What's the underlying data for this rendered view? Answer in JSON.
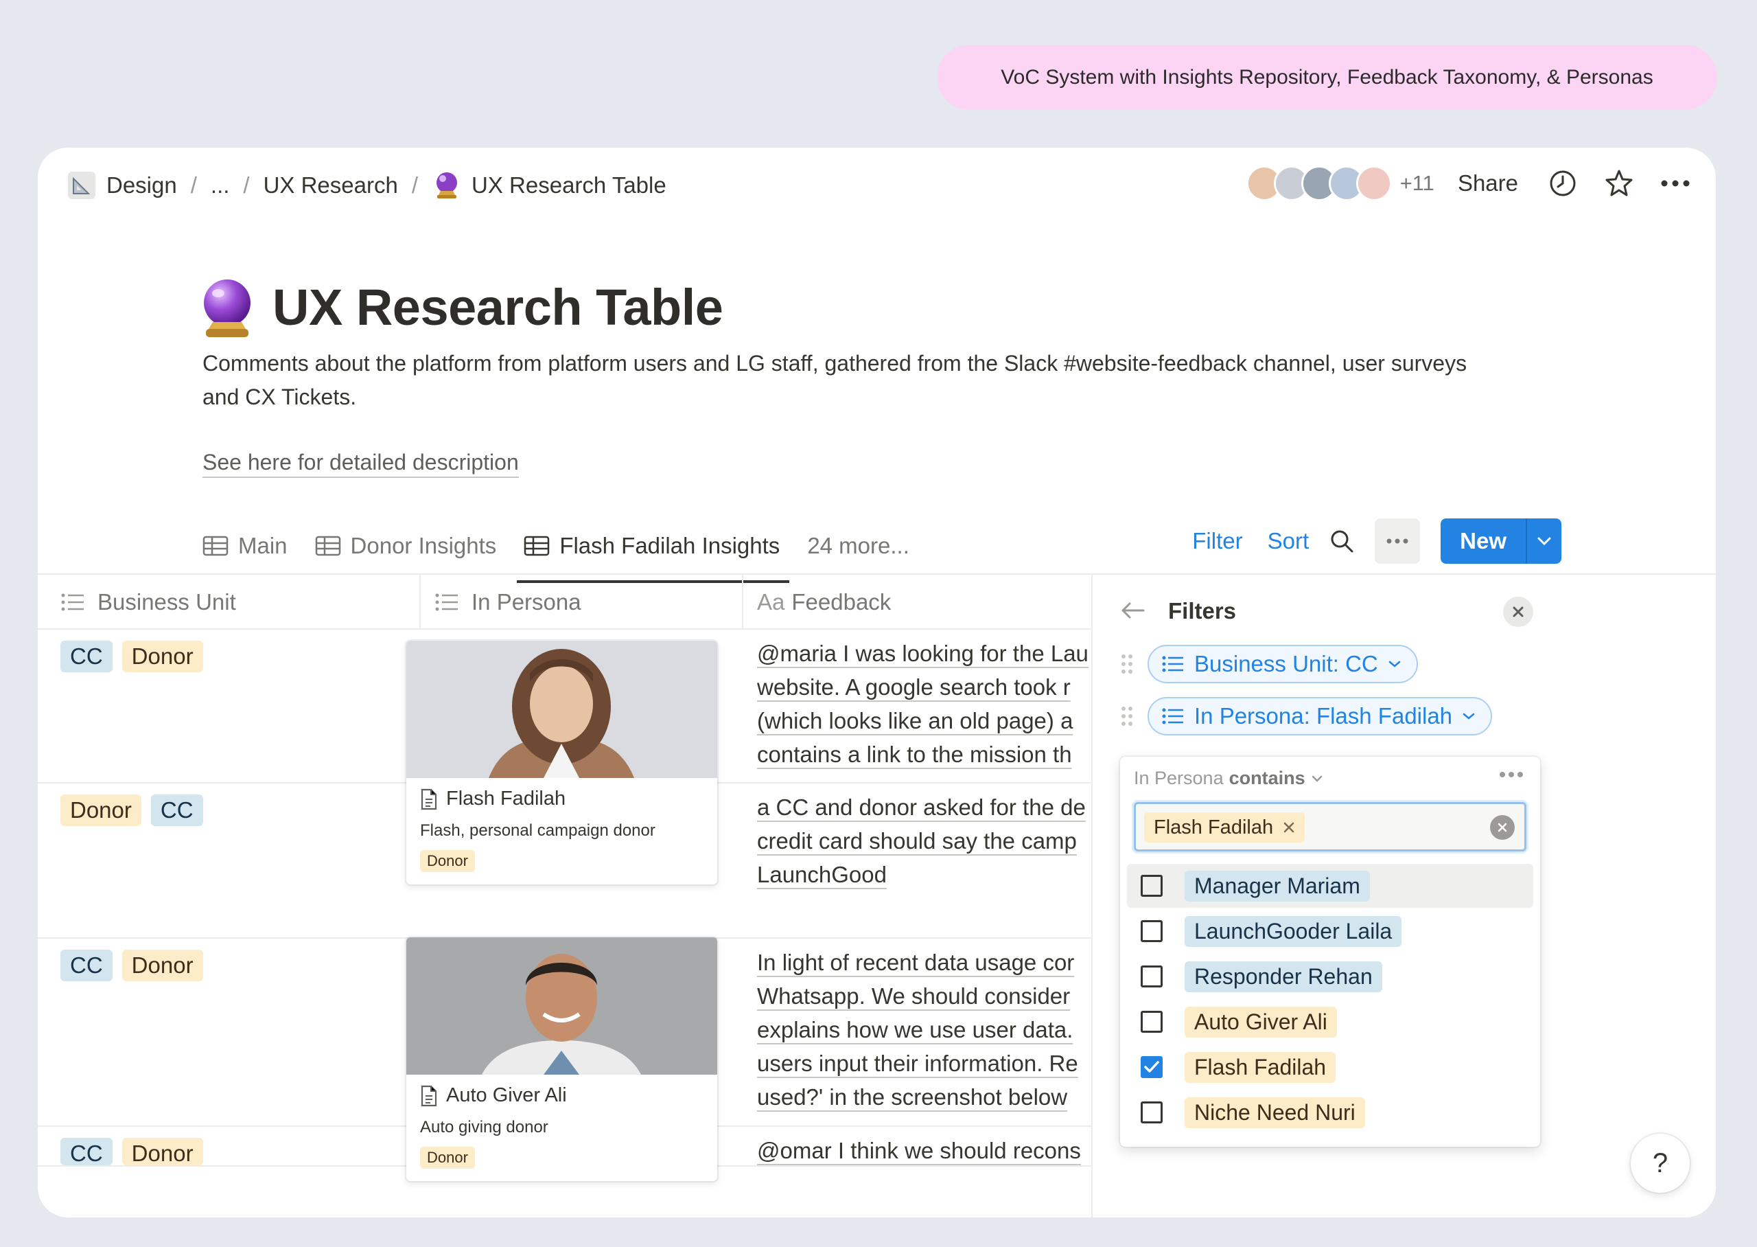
{
  "banner": "VoC System with Insights Repository, Feedback Taxonomy, & Personas",
  "breadcrumb": [
    {
      "label": "Design",
      "icon": "triangle-ruler-icon"
    },
    {
      "label": "..."
    },
    {
      "label": "UX Research"
    },
    {
      "label": "UX Research Table",
      "icon": "crystal-ball-icon"
    }
  ],
  "topbar": {
    "extra_collaborators": "+11",
    "share": "Share"
  },
  "page": {
    "title": "UX Research Table",
    "description": "Comments about the platform from platform users and LG staff, gathered from the Slack #website-feedback channel, user surveys and CX Tickets.",
    "link": "See here for detailed description"
  },
  "tabs": [
    {
      "label": "Main",
      "active": false
    },
    {
      "label": "Donor Insights",
      "active": false
    },
    {
      "label": "Flash Fadilah Insights",
      "active": true
    }
  ],
  "tabs_more": "24 more...",
  "actions": {
    "filter": "Filter",
    "sort": "Sort",
    "new": "New"
  },
  "columns": {
    "business_unit": "Business Unit",
    "in_persona": "In Persona",
    "feedback_prefix": "Aa",
    "feedback": "Feedback"
  },
  "rows": [
    {
      "business_unit": [
        "CC",
        "Donor"
      ],
      "feedback": [
        "@maria I was looking for the Lau",
        "website. A google search took r",
        "(which looks like an old page) a",
        "contains a link to the mission th"
      ]
    },
    {
      "business_unit": [
        "Donor",
        "CC"
      ],
      "feedback": [
        "a CC and donor asked for the de",
        "credit card should say the camp",
        "LaunchGood"
      ]
    },
    {
      "business_unit": [
        "CC",
        "Donor"
      ],
      "feedback": [
        "In light of recent data usage cor",
        "Whatsapp. We should consider",
        "explains how we use user data.",
        "users input their information. Re",
        "used?' in the screenshot below"
      ]
    },
    {
      "business_unit": [
        "CC",
        "Donor"
      ],
      "feedback": [
        "@omar I think we should recons"
      ]
    }
  ],
  "persona_cards": [
    {
      "name": "Flash Fadilah",
      "description": "Flash, personal campaign donor",
      "tag": "Donor"
    },
    {
      "name": "Auto Giver Ali",
      "description": "Auto giving donor",
      "tag": "Donor"
    }
  ],
  "filters_panel": {
    "title": "Filters",
    "chips": [
      "Business Unit: CC",
      "In Persona: Flash Fadilah"
    ],
    "dropdown": {
      "property": "In Persona",
      "operator": "contains",
      "selected_value": "Flash Fadilah",
      "options": [
        {
          "label": "Manager Mariam",
          "checked": false,
          "color": "#d3e5ef"
        },
        {
          "label": "LaunchGooder Laila",
          "checked": false,
          "color": "#d3e5ef"
        },
        {
          "label": "Responder Rehan",
          "checked": false,
          "color": "#d3e5ef"
        },
        {
          "label": "Auto Giver Ali",
          "checked": false,
          "color": "#fdecc8"
        },
        {
          "label": "Flash Fadilah",
          "checked": true,
          "color": "#fdecc8"
        },
        {
          "label": "Niche Need Nuri",
          "checked": false,
          "color": "#fdecc8"
        }
      ]
    }
  },
  "help": "?",
  "colors": {
    "accent": "#2383e2",
    "banner": "#fbd5f3",
    "tag_cc": "#d3e5ef",
    "tag_donor": "#fdecc8"
  }
}
